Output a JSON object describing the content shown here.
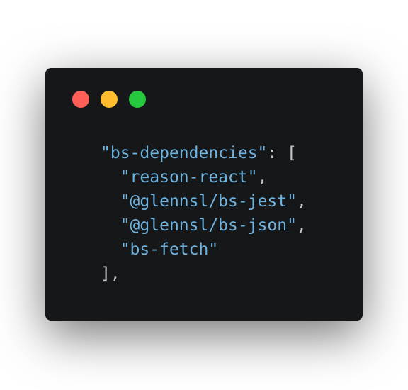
{
  "window": {
    "controls": {
      "close_color": "#ff5f56",
      "minimize_color": "#ffbd2e",
      "maximize_color": "#27c93f"
    }
  },
  "code": {
    "lines": [
      {
        "indent": "",
        "string": "\"bs-dependencies\"",
        "punct": ": ["
      },
      {
        "indent": "  ",
        "string": "\"reason-react\"",
        "punct": ","
      },
      {
        "indent": "  ",
        "string": "\"@glennsl/bs-jest\"",
        "punct": ","
      },
      {
        "indent": "  ",
        "string": "\"@glennsl/bs-json\"",
        "punct": ","
      },
      {
        "indent": "  ",
        "string": "\"bs-fetch\"",
        "punct": ""
      },
      {
        "indent": "",
        "string": "",
        "punct": "],"
      }
    ],
    "colors": {
      "string": "#6fb3e0",
      "punctuation": "#c5c8c6",
      "background": "#151718"
    }
  }
}
